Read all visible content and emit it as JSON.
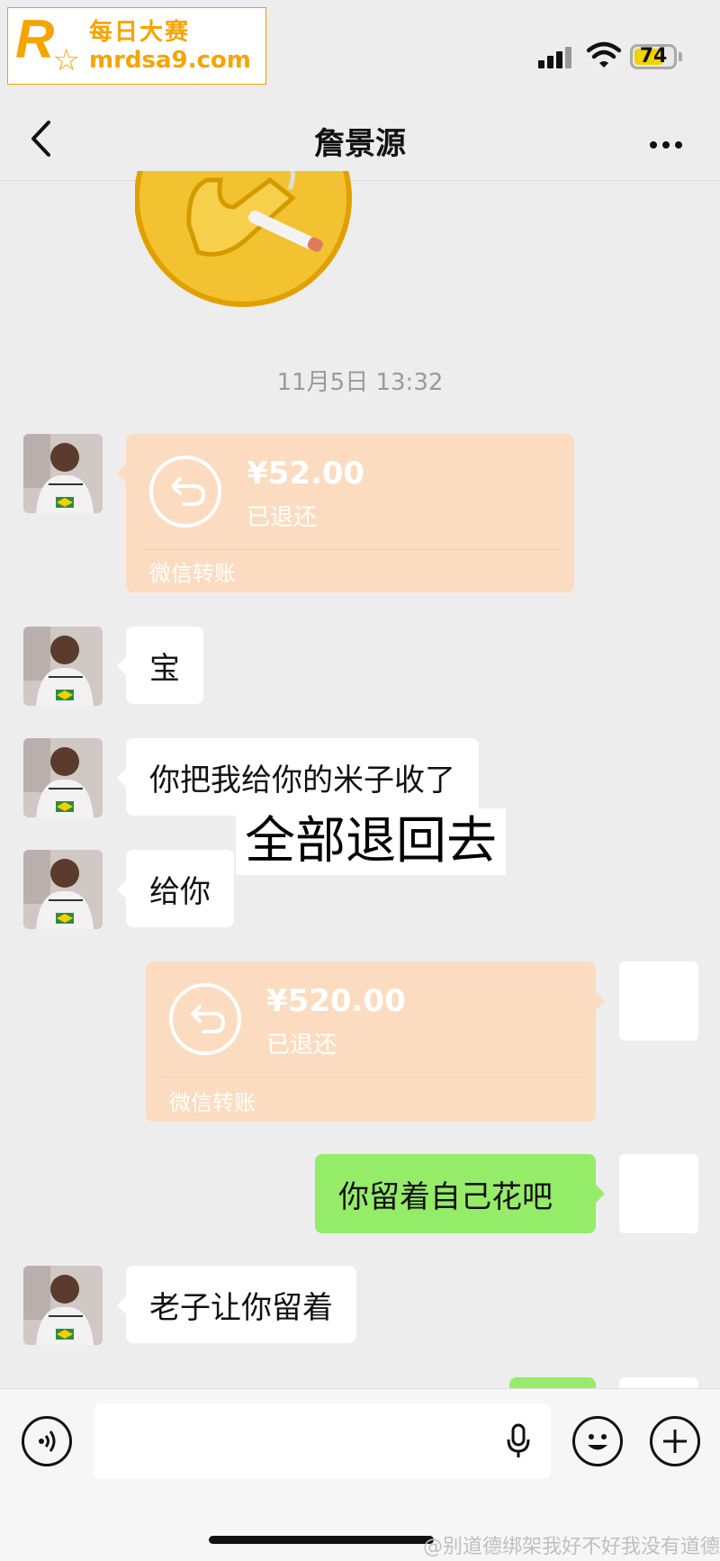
{
  "watermark": {
    "brand_cn": "每日大赛",
    "site": "mrdsa9.com",
    "logo_letter": "R"
  },
  "status_bar": {
    "battery": "74"
  },
  "nav": {
    "title": "詹景源",
    "back_icon": "chevron-left-icon",
    "more_icon": "more-dots-icon"
  },
  "timestamp": "11月5日 13:32",
  "messages": {
    "transfer1": {
      "amount": "¥52.00",
      "status": "已退还",
      "label": "微信转账"
    },
    "m1": "宝",
    "m2": "你把我给你的米子收了",
    "m3": "给你",
    "transfer2": {
      "amount": "¥520.00",
      "status": "已退还",
      "label": "微信转账"
    },
    "m4": "你留着自己花吧",
    "m5": "老子让你留着"
  },
  "caption": "全部退回去",
  "input_bar": {
    "voice_icon": "voice-icon",
    "mic_icon": "mic-icon",
    "emoji_icon": "emoji-icon",
    "plus_icon": "plus-icon"
  },
  "footer_watermark": "@别道德绑架我好不好我没有道德",
  "colors": {
    "transfer": "#fbdcc0",
    "green_bubble": "#95ec69",
    "background": "#ededed",
    "accent_logo": "#f6a400"
  }
}
